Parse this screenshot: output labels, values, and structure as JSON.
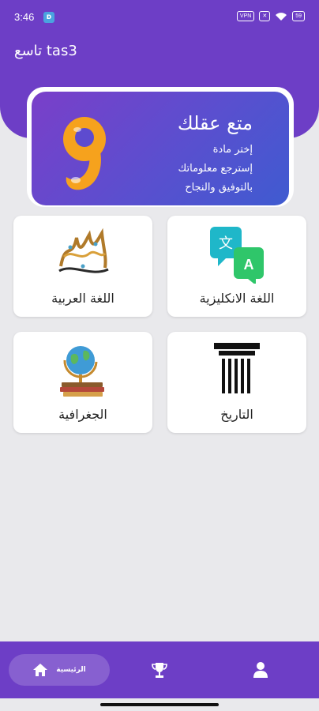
{
  "status_bar": {
    "time": "3:46",
    "vpn_label": "VPN",
    "battery": "59"
  },
  "header": {
    "title": "تاسع tas3"
  },
  "banner": {
    "title": "متع عقلك",
    "lines": [
      "إختر مادة",
      "إسترجع معلوماتك",
      "بالتوفيق والنجاح"
    ],
    "icon": "number-nine-icon"
  },
  "subjects": [
    {
      "label": "اللغة الانكليزية",
      "icon": "translate-icon"
    },
    {
      "label": "اللغة العربية",
      "icon": "arabic-calligraphy-icon"
    },
    {
      "label": "التاريخ",
      "icon": "greek-column-icon"
    },
    {
      "label": "الجغرافية",
      "icon": "globe-books-icon"
    }
  ],
  "bottom_nav": {
    "home_label": "الرئيسية",
    "items": [
      "home-icon",
      "trophy-icon",
      "user-icon"
    ]
  },
  "colors": {
    "primary": "#6d3ec6",
    "background": "#e9e9ec",
    "card": "#ffffff"
  }
}
